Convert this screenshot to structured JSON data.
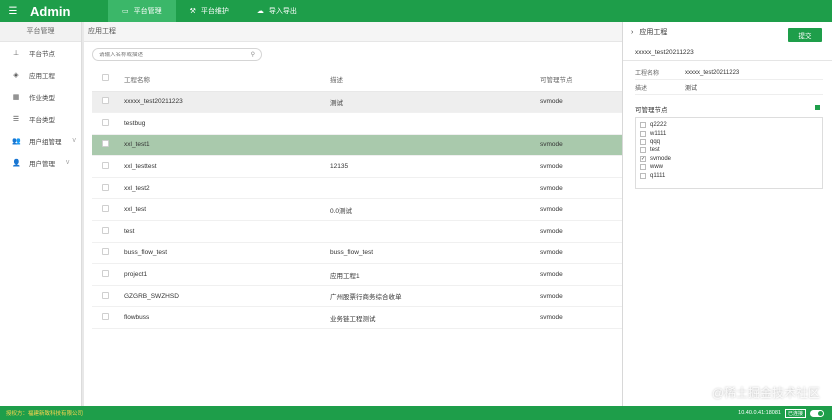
{
  "header": {
    "brand": "Admin",
    "nav": [
      {
        "label": "平台管理",
        "icon": "monitor-icon"
      },
      {
        "label": "平台维护",
        "icon": "wrench-icon"
      },
      {
        "label": "导入导出",
        "icon": "cloud-icon"
      }
    ]
  },
  "sidebar": {
    "title": "平台管理",
    "items": [
      {
        "label": "平台节点",
        "icon": "sitemap-icon"
      },
      {
        "label": "应用工程",
        "icon": "cube-icon"
      },
      {
        "label": "作业类型",
        "icon": "grid-icon"
      },
      {
        "label": "平台类型",
        "icon": "list-icon"
      },
      {
        "label": "用户组管理",
        "icon": "users-icon",
        "arrow": "V"
      },
      {
        "label": "用户管理",
        "icon": "user-icon",
        "arrow": "V"
      }
    ]
  },
  "main": {
    "breadcrumb": "应用工程",
    "search_placeholder": "请输入名称或描述",
    "columns": [
      "工程名称",
      "描述",
      "可管理节点"
    ],
    "rows": [
      {
        "name": "xxxxx_test20211223",
        "desc": "测试",
        "node": "svmode"
      },
      {
        "name": "testbug",
        "desc": "",
        "node": ""
      },
      {
        "name": "xxl_test1",
        "desc": "",
        "node": "svmode"
      },
      {
        "name": "xxl_testtest",
        "desc": "12135",
        "node": "svmode"
      },
      {
        "name": "xxl_test2",
        "desc": "",
        "node": "svmode"
      },
      {
        "name": "xxl_test",
        "desc": "0.0测试",
        "node": "svmode"
      },
      {
        "name": "test",
        "desc": "",
        "node": "svmode"
      },
      {
        "name": "buss_flow_test",
        "desc": "buss_flow_test",
        "node": "svmode"
      },
      {
        "name": "project1",
        "desc": "应用工程1",
        "node": "svmode"
      },
      {
        "name": "GZGRB_SWZHSD",
        "desc": "广州股票行商务综合收单",
        "node": "svmode"
      },
      {
        "name": "flowbuss",
        "desc": "业务链工程测试",
        "node": "svmode"
      }
    ]
  },
  "panel": {
    "title": "应用工程",
    "submit": "提交",
    "project": "xxxxx_test20211223",
    "name_label": "工程名称",
    "name_value": "xxxxx_test20211223",
    "desc_label": "描述",
    "desc_value": "测试",
    "nodes_title": "可管理节点",
    "nodes": [
      {
        "label": "q2222",
        "checked": ""
      },
      {
        "label": "w1111",
        "checked": ""
      },
      {
        "label": "qqq",
        "checked": ""
      },
      {
        "label": "test",
        "checked": ""
      },
      {
        "label": "svmode",
        "checked": "✓"
      },
      {
        "label": "www",
        "checked": ""
      },
      {
        "label": "q1111",
        "checked": ""
      }
    ]
  },
  "footer": {
    "left": "授权方：福建新致科技有限公司",
    "ip": "10.40.0.41:18081",
    "status": "已连接"
  },
  "watermark": "@稀土掘金技术社区"
}
